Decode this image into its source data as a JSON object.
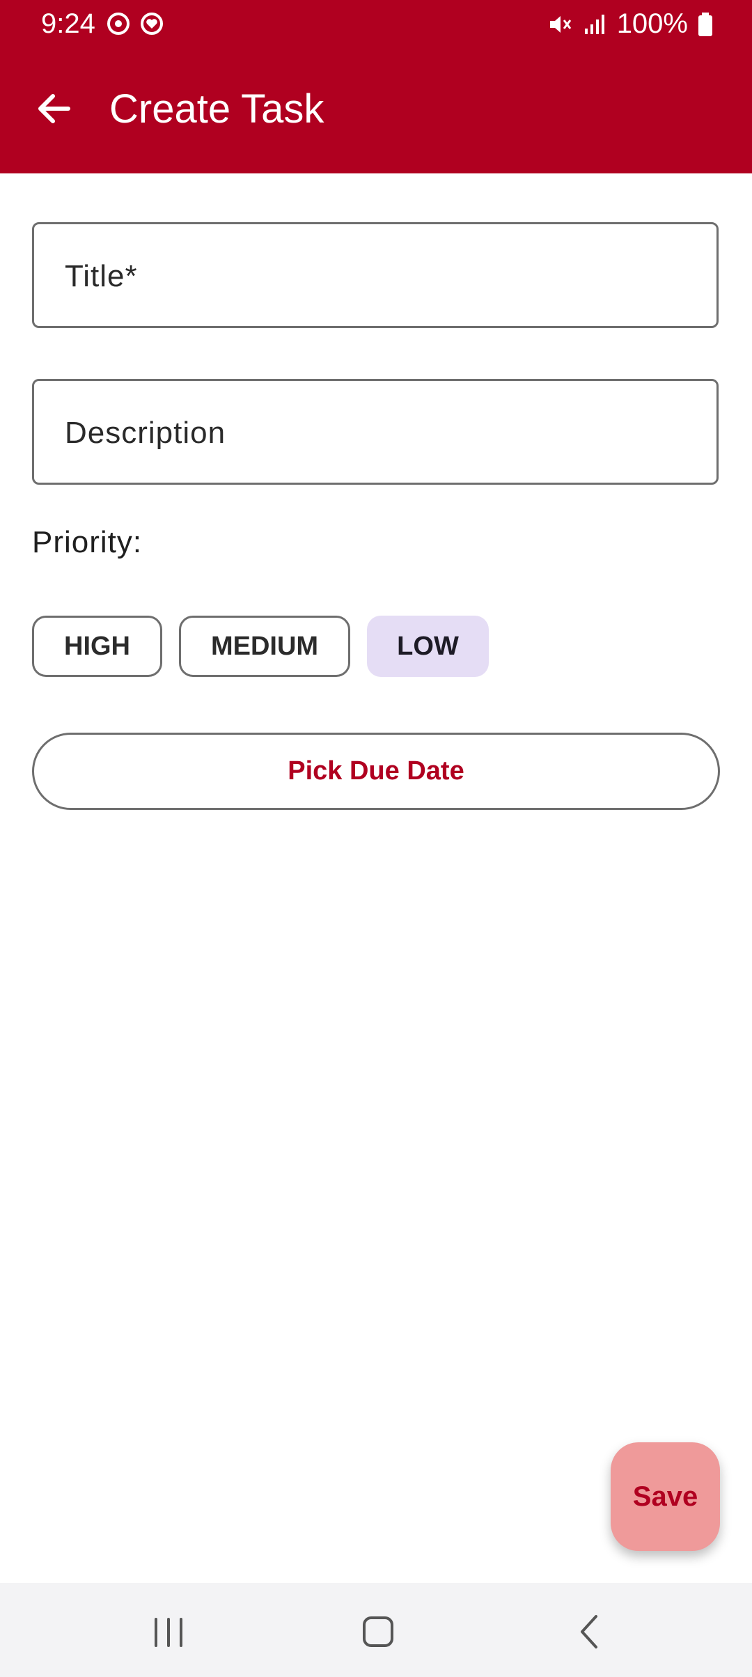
{
  "status_bar": {
    "time": "9:24",
    "battery": "100%",
    "left_icons": [
      "sync-icon",
      "heart-status-icon"
    ],
    "right_icons": [
      "mute-icon",
      "signal-icon",
      "battery-icon"
    ]
  },
  "app_bar": {
    "title": "Create Task",
    "back_icon": "arrow-left-icon"
  },
  "form": {
    "title_placeholder": "Title*",
    "description_placeholder": "Description",
    "priority_label": "Priority:",
    "priority_options": [
      {
        "label": "HIGH",
        "selected": false
      },
      {
        "label": "MEDIUM",
        "selected": false
      },
      {
        "label": "LOW",
        "selected": true
      }
    ],
    "due_date_button": "Pick Due Date"
  },
  "fab": {
    "label": "Save"
  },
  "colors": {
    "primary": "#b00020",
    "fab_bg": "#ef9a9a",
    "selected_chip_bg": "#e5ddf5"
  },
  "nav": [
    "recents-icon",
    "home-icon",
    "back-icon"
  ]
}
